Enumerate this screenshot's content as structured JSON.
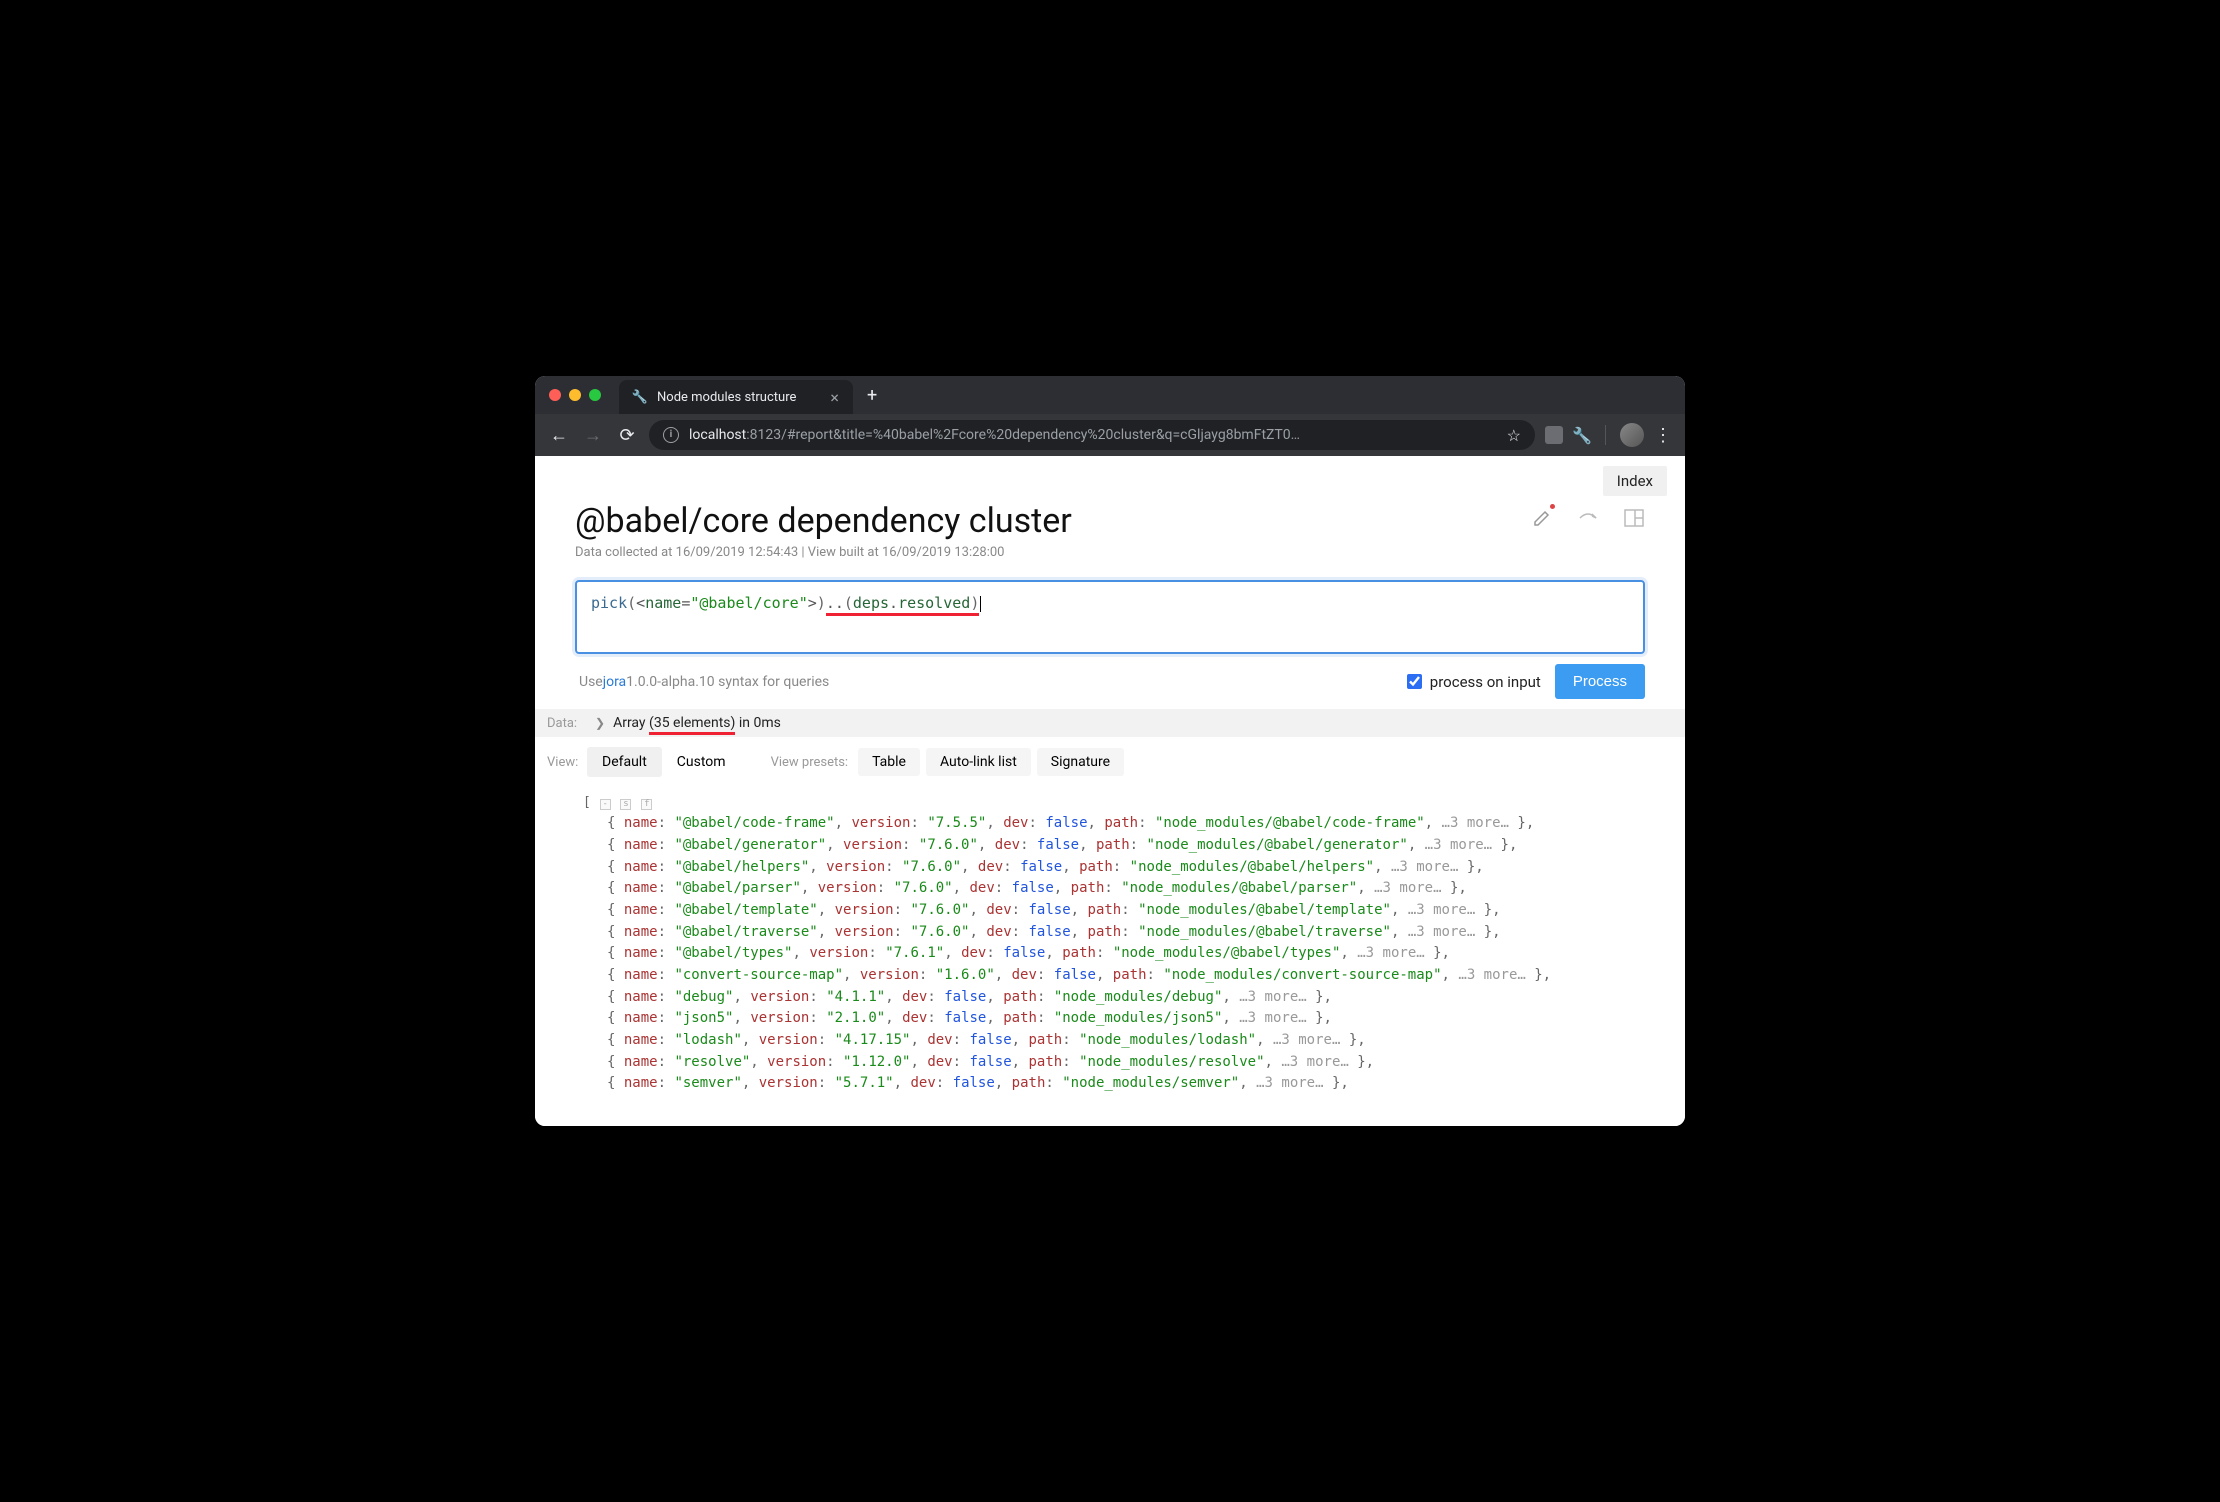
{
  "browser": {
    "tab_title": "Node modules structure",
    "url_host": "localhost",
    "url_port": ":8123",
    "url_path": "/#report&title=%40babel%2Fcore%20dependency%20cluster&q=cGljayg8bmFtZT0…"
  },
  "page": {
    "index_label": "Index",
    "title": "@babel/core dependency cluster",
    "subtitle": "Data collected at 16/09/2019 12:54:43 | View built at 16/09/2019 13:28:00"
  },
  "query": {
    "parts": {
      "fn": "pick",
      "lp": "(",
      "lt": "<",
      "attr": "name",
      "eq": "=",
      "val": "\"@babel/core\"",
      "gt": ">",
      "rp": ")",
      "dots": "..",
      "lp2": "(",
      "deps": "deps",
      "dot": ".",
      "resolved": "resolved",
      "rp2": ")"
    },
    "hint_prefix": "Use ",
    "hint_link": "jora",
    "hint_suffix": " 1.0.0-alpha.10 syntax for queries",
    "process_on_input": "process on input",
    "process_btn": "Process"
  },
  "data_row": {
    "label": "Data:",
    "expand": "❯",
    "array": "Array ",
    "count": "(35 elements)",
    "time": " in 0ms"
  },
  "view_row": {
    "label": "View:",
    "default": "Default",
    "custom": "Custom",
    "presets_label": "View presets:",
    "presets": [
      "Table",
      "Auto-link list",
      "Signature"
    ]
  },
  "output_more": "…3 more…",
  "output": [
    {
      "name": "@babel/code-frame",
      "version": "7.5.5",
      "dev": false,
      "path": "node_modules/@babel/code-frame"
    },
    {
      "name": "@babel/generator",
      "version": "7.6.0",
      "dev": false,
      "path": "node_modules/@babel/generator"
    },
    {
      "name": "@babel/helpers",
      "version": "7.6.0",
      "dev": false,
      "path": "node_modules/@babel/helpers"
    },
    {
      "name": "@babel/parser",
      "version": "7.6.0",
      "dev": false,
      "path": "node_modules/@babel/parser"
    },
    {
      "name": "@babel/template",
      "version": "7.6.0",
      "dev": false,
      "path": "node_modules/@babel/template"
    },
    {
      "name": "@babel/traverse",
      "version": "7.6.0",
      "dev": false,
      "path": "node_modules/@babel/traverse"
    },
    {
      "name": "@babel/types",
      "version": "7.6.1",
      "dev": false,
      "path": "node_modules/@babel/types"
    },
    {
      "name": "convert-source-map",
      "version": "1.6.0",
      "dev": false,
      "path": "node_modules/convert-source-map"
    },
    {
      "name": "debug",
      "version": "4.1.1",
      "dev": false,
      "path": "node_modules/debug"
    },
    {
      "name": "json5",
      "version": "2.1.0",
      "dev": false,
      "path": "node_modules/json5"
    },
    {
      "name": "lodash",
      "version": "4.17.15",
      "dev": false,
      "path": "node_modules/lodash"
    },
    {
      "name": "resolve",
      "version": "1.12.0",
      "dev": false,
      "path": "node_modules/resolve"
    },
    {
      "name": "semver",
      "version": "5.7.1",
      "dev": false,
      "path": "node_modules/semver"
    }
  ]
}
